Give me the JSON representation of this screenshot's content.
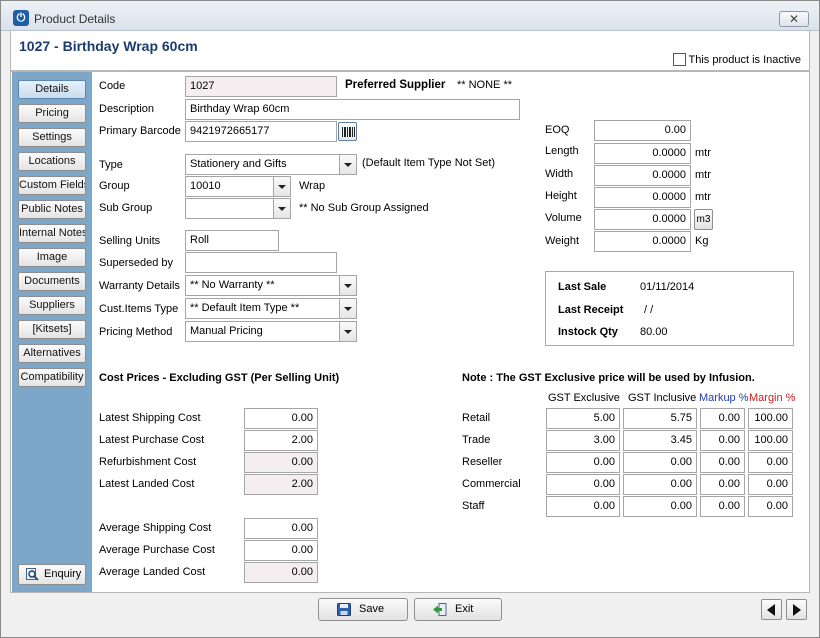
{
  "window": {
    "title": "Product Details",
    "close_glyph": "✕"
  },
  "header": {
    "product_title": "1027 - Birthday Wrap 60cm",
    "inactive_label": "This product is Inactive"
  },
  "sidebar": {
    "items": [
      "Details",
      "Pricing",
      "Settings",
      "Locations",
      "Custom Fields",
      "Public Notes",
      "Internal Notes",
      "Image",
      "Documents",
      "Suppliers",
      "[Kitsets]",
      "Alternatives",
      "Compatibility"
    ],
    "enquiry_label": "Enquiry"
  },
  "details": {
    "code_label": "Code",
    "code": "1027",
    "preferred_supplier_label": "Preferred Supplier",
    "preferred_supplier": "** NONE **",
    "description_label": "Description",
    "description": "Birthday Wrap 60cm",
    "barcode_label": "Primary Barcode",
    "barcode": "9421972665177",
    "type_label": "Type",
    "type": "Stationery and Gifts",
    "type_note": "(Default Item Type Not Set)",
    "group_label": "Group",
    "group": "10010",
    "group_name": "Wrap",
    "subgroup_label": "Sub Group",
    "subgroup": "",
    "subgroup_note": "** No Sub Group Assigned",
    "selling_units_label": "Selling Units",
    "selling_units": "Roll",
    "superseded_label": "Superseded by",
    "superseded": "",
    "warranty_label": "Warranty Details",
    "warranty": "** No Warranty **",
    "cust_items_label": "Cust.Items Type",
    "cust_items": "** Default Item Type **",
    "pricing_method_label": "Pricing Method",
    "pricing_method": "Manual Pricing"
  },
  "dimensions": {
    "eoq_label": "EOQ",
    "eoq": "0.00",
    "length_label": "Length",
    "length": "0.0000",
    "length_unit": "mtr",
    "width_label": "Width",
    "width": "0.0000",
    "width_unit": "mtr",
    "height_label": "Height",
    "height": "0.0000",
    "height_unit": "mtr",
    "volume_label": "Volume",
    "volume": "0.0000",
    "volume_unit_btn": "m3",
    "weight_label": "Weight",
    "weight": "0.0000",
    "weight_unit": "Kg"
  },
  "sales": {
    "last_sale_label": "Last Sale",
    "last_sale": "01/11/2014",
    "last_receipt_label": "Last Receipt",
    "last_receipt": "/  /",
    "instock_label": "Instock Qty",
    "instock": "80.00"
  },
  "costs": {
    "heading": "Cost Prices - Excluding GST (Per Selling Unit)",
    "latest_shipping_label": "Latest Shipping Cost",
    "latest_shipping": "0.00",
    "latest_purchase_label": "Latest Purchase Cost",
    "latest_purchase": "2.00",
    "refurbishment_label": "Refurbishment Cost",
    "refurbishment": "0.00",
    "latest_landed_label": "Latest Landed Cost",
    "latest_landed": "2.00",
    "avg_shipping_label": "Average Shipping Cost",
    "avg_shipping": "0.00",
    "avg_purchase_label": "Average Purchase Cost",
    "avg_purchase": "0.00",
    "avg_landed_label": "Average Landed Cost",
    "avg_landed": "0.00"
  },
  "prices": {
    "note": "Note : The GST Exclusive price will be used by Infusion.",
    "col_excl": "GST Exclusive",
    "col_incl": "GST Inclusive",
    "col_markup": "Markup %",
    "col_margin": "Margin %",
    "rows": [
      {
        "label": "Retail",
        "excl": "5.00",
        "incl": "5.75",
        "markup": "0.00",
        "margin": "100.00"
      },
      {
        "label": "Trade",
        "excl": "3.00",
        "incl": "3.45",
        "markup": "0.00",
        "margin": "100.00"
      },
      {
        "label": "Reseller",
        "excl": "0.00",
        "incl": "0.00",
        "markup": "0.00",
        "margin": "0.00"
      },
      {
        "label": "Commercial",
        "excl": "0.00",
        "incl": "0.00",
        "markup": "0.00",
        "margin": "0.00"
      },
      {
        "label": "Staff",
        "excl": "0.00",
        "incl": "0.00",
        "markup": "0.00",
        "margin": "0.00"
      }
    ]
  },
  "footer": {
    "save_label": "Save",
    "exit_label": "Exit"
  },
  "colors": {
    "sidebar_bg": "#7da7c8",
    "title_blue": "#1c3c6e",
    "markup_blue": "#1e3fb0",
    "margin_red": "#d11a1a"
  }
}
